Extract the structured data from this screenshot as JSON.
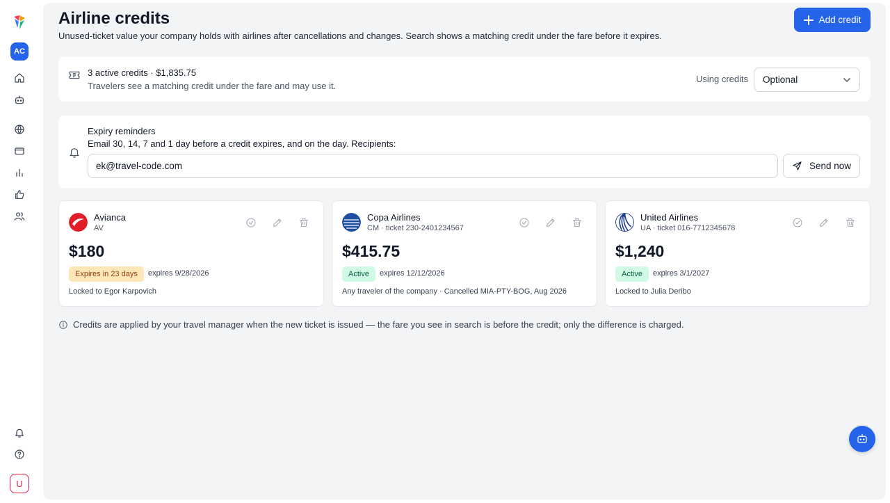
{
  "sidebar": {
    "org_initials": "AC",
    "user_initial": "U",
    "items": [
      {
        "icon": "home-icon"
      },
      {
        "icon": "chat-bot-icon"
      },
      {
        "icon": "globe-icon"
      },
      {
        "icon": "card-icon"
      },
      {
        "icon": "bar-chart-icon"
      },
      {
        "icon": "thumbs-up-icon"
      },
      {
        "icon": "users-icon"
      }
    ],
    "bottom_items": [
      {
        "icon": "bell-icon"
      },
      {
        "icon": "help-icon"
      }
    ]
  },
  "header": {
    "title": "Airline credits",
    "subtitle": "Unused-ticket value your company holds with airlines after cancellations and changes. Search shows a matching credit under the fare before it expires.",
    "add_label": "Add credit"
  },
  "summary": {
    "headline": "3 active credits · $1,835.75",
    "text": "Travelers see a matching credit under the fare and may use it.",
    "using_label": "Using credits",
    "using_value": "Optional"
  },
  "reminders": {
    "title": "Expiry reminders",
    "desc": "Email 30, 14, 7 and 1 day before a credit expires, and on the day. Recipients:",
    "recipients": "ek@travel-code.com",
    "send_label": "Send now"
  },
  "credits": [
    {
      "airline": "Avianca",
      "meta": "AV",
      "amount": "$180",
      "badge": "Expires in 23 days",
      "badge_kind": "warn",
      "expires": "expires 9/28/2026",
      "note": "Locked to Egor Karpovich",
      "logo_color": "#e11d2a"
    },
    {
      "airline": "Copa Airlines",
      "meta": "CM · ticket 230-2401234567",
      "amount": "$415.75",
      "badge": "Active",
      "badge_kind": "ok",
      "expires": "expires 12/12/2026",
      "note": "Any traveler of the company · Cancelled MIA-PTY-BOG, Aug 2026",
      "logo_color": "#1e4fa3"
    },
    {
      "airline": "United Airlines",
      "meta": "UA · ticket 016-7712345678",
      "amount": "$1,240",
      "badge": "Active",
      "badge_kind": "ok",
      "expires": "expires 3/1/2027",
      "note": "Locked to Julia Deribo",
      "logo_color": "#1d3b8f"
    }
  ],
  "footnote": "Credits are applied by your travel manager when the new ticket is issued — the fare you see in search is before the credit; only the difference is charged."
}
